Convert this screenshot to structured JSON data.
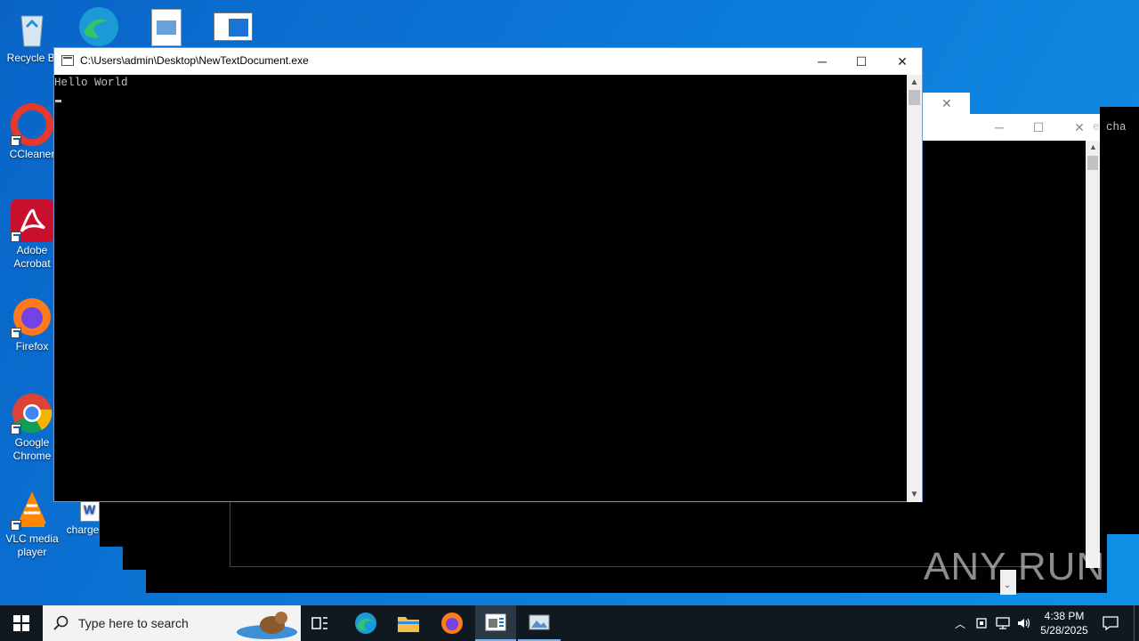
{
  "desktop": {
    "icons": [
      {
        "label": "Recycle Bi",
        "icon": "recycle-bin-icon"
      },
      {
        "label": "CCleaner",
        "icon": "ccleaner-icon"
      },
      {
        "label": "Adobe Acrobat",
        "icon": "acrobat-icon"
      },
      {
        "label": "Firefox",
        "icon": "firefox-icon"
      },
      {
        "label": "Google Chrome",
        "icon": "chrome-icon"
      },
      {
        "label": "VLC media player",
        "icon": "vlc-icon"
      },
      {
        "label": "charge",
        "icon": "word-doc-icon"
      }
    ]
  },
  "background_window": {
    "text_fragment": "e cha"
  },
  "console": {
    "title": "C:\\Users\\admin\\Desktop\\NewTextDocument.exe",
    "output_line": "Hello World"
  },
  "taskbar": {
    "search_placeholder": "Type here to search",
    "time": "4:38 PM",
    "date": "5/28/2025"
  },
  "watermark": "ANY RUN",
  "colors": {
    "desktop_bg": "#0b78d7",
    "taskbar_bg": "#101820",
    "console_bg": "#000000",
    "console_text": "#c0c0c0"
  }
}
